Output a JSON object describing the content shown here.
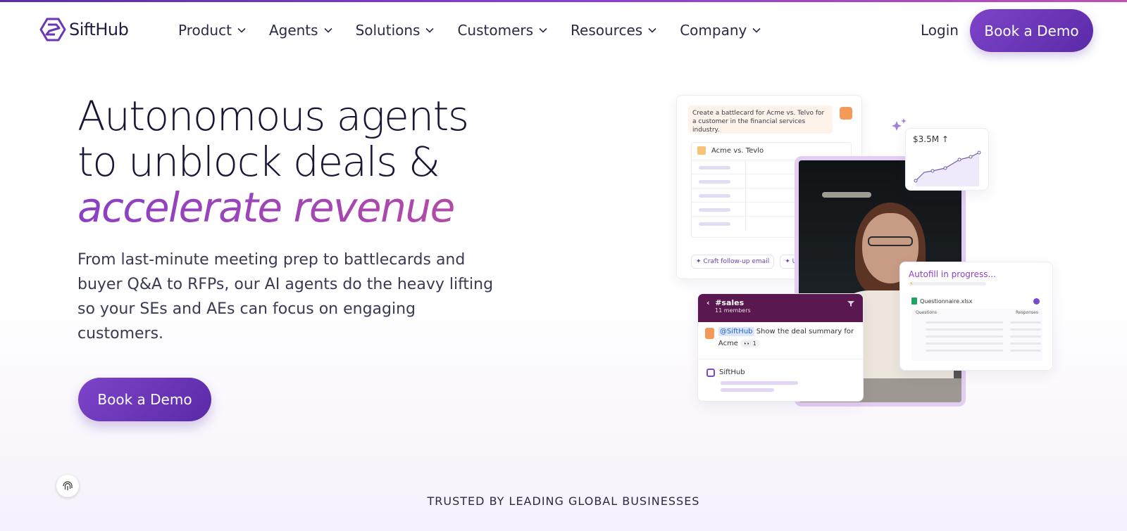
{
  "brand": {
    "name": "SiftHub"
  },
  "nav": {
    "items": [
      {
        "label": "Product"
      },
      {
        "label": "Agents"
      },
      {
        "label": "Solutions"
      },
      {
        "label": "Customers"
      },
      {
        "label": "Resources"
      },
      {
        "label": "Company"
      }
    ],
    "login_label": "Login",
    "cta_label": "Book a Demo"
  },
  "hero": {
    "title_line1": "Autonomous agents",
    "title_line2": "to unblock deals &",
    "title_accent": "accelerate revenue",
    "subtitle": "From last-minute meeting prep to battlecards and buyer Q&A to RFPs, our AI agents do the heavy lifting so your SEs and AEs can focus on engaging customers.",
    "cta_label": "Book a Demo"
  },
  "illustration": {
    "battlecard": {
      "prompt": "Create a battlecard for Acme vs. Telvo for a customer in the financial services industry.",
      "table_title": "Acme vs. Tevlo",
      "chips": [
        "Craft follow-up email",
        "Up"
      ]
    },
    "metric": {
      "value": "$3.5M ↑"
    },
    "slack": {
      "channel": "#sales",
      "members": "11 members",
      "mention": "@SiftHub",
      "message": "Show the deal summary for Acme",
      "reaction": "👀 1",
      "reply_name": "SiftHub"
    },
    "autofill": {
      "title": "Autofill in progress...",
      "file": "Questionnaire.xlsx",
      "col_questions": "Questions",
      "col_responses": "Responses"
    }
  },
  "trusted_label": "TRUSTED BY LEADING GLOBAL BUSINESSES",
  "colors": {
    "primary": "#6a35b8",
    "accent": "#9a47b4",
    "slack": "#5a1850"
  }
}
